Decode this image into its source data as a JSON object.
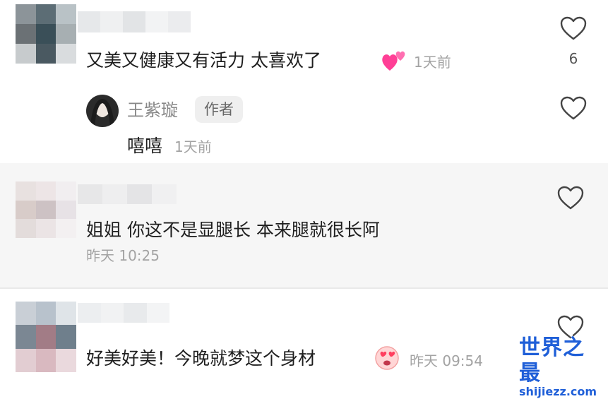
{
  "comments": [
    {
      "text": "又美又健康又有活力 太喜欢了",
      "emoji": "two-hearts-emoji",
      "time": "1天前",
      "like_count": "6"
    },
    {
      "text": "姐姐 你这不是显腿长 本来腿就很长阿",
      "time": "昨天 10:25"
    },
    {
      "text": "好美好美！今晚就梦这个身材",
      "emoji": "heart-eyes-face-emoji",
      "time": "昨天 09:54"
    }
  ],
  "reply": {
    "username": "王紫璇",
    "badge": "作者",
    "text": "嘻嘻",
    "time": "1天前"
  },
  "watermark": {
    "title": "世界之最",
    "url": "shijiezz.com"
  },
  "colors": {
    "accent": "#1f5fd8",
    "meta_text": "#a3a3a3",
    "highlight_bg": "#f6f6f6",
    "emoji_pink": "#ff3f96"
  }
}
